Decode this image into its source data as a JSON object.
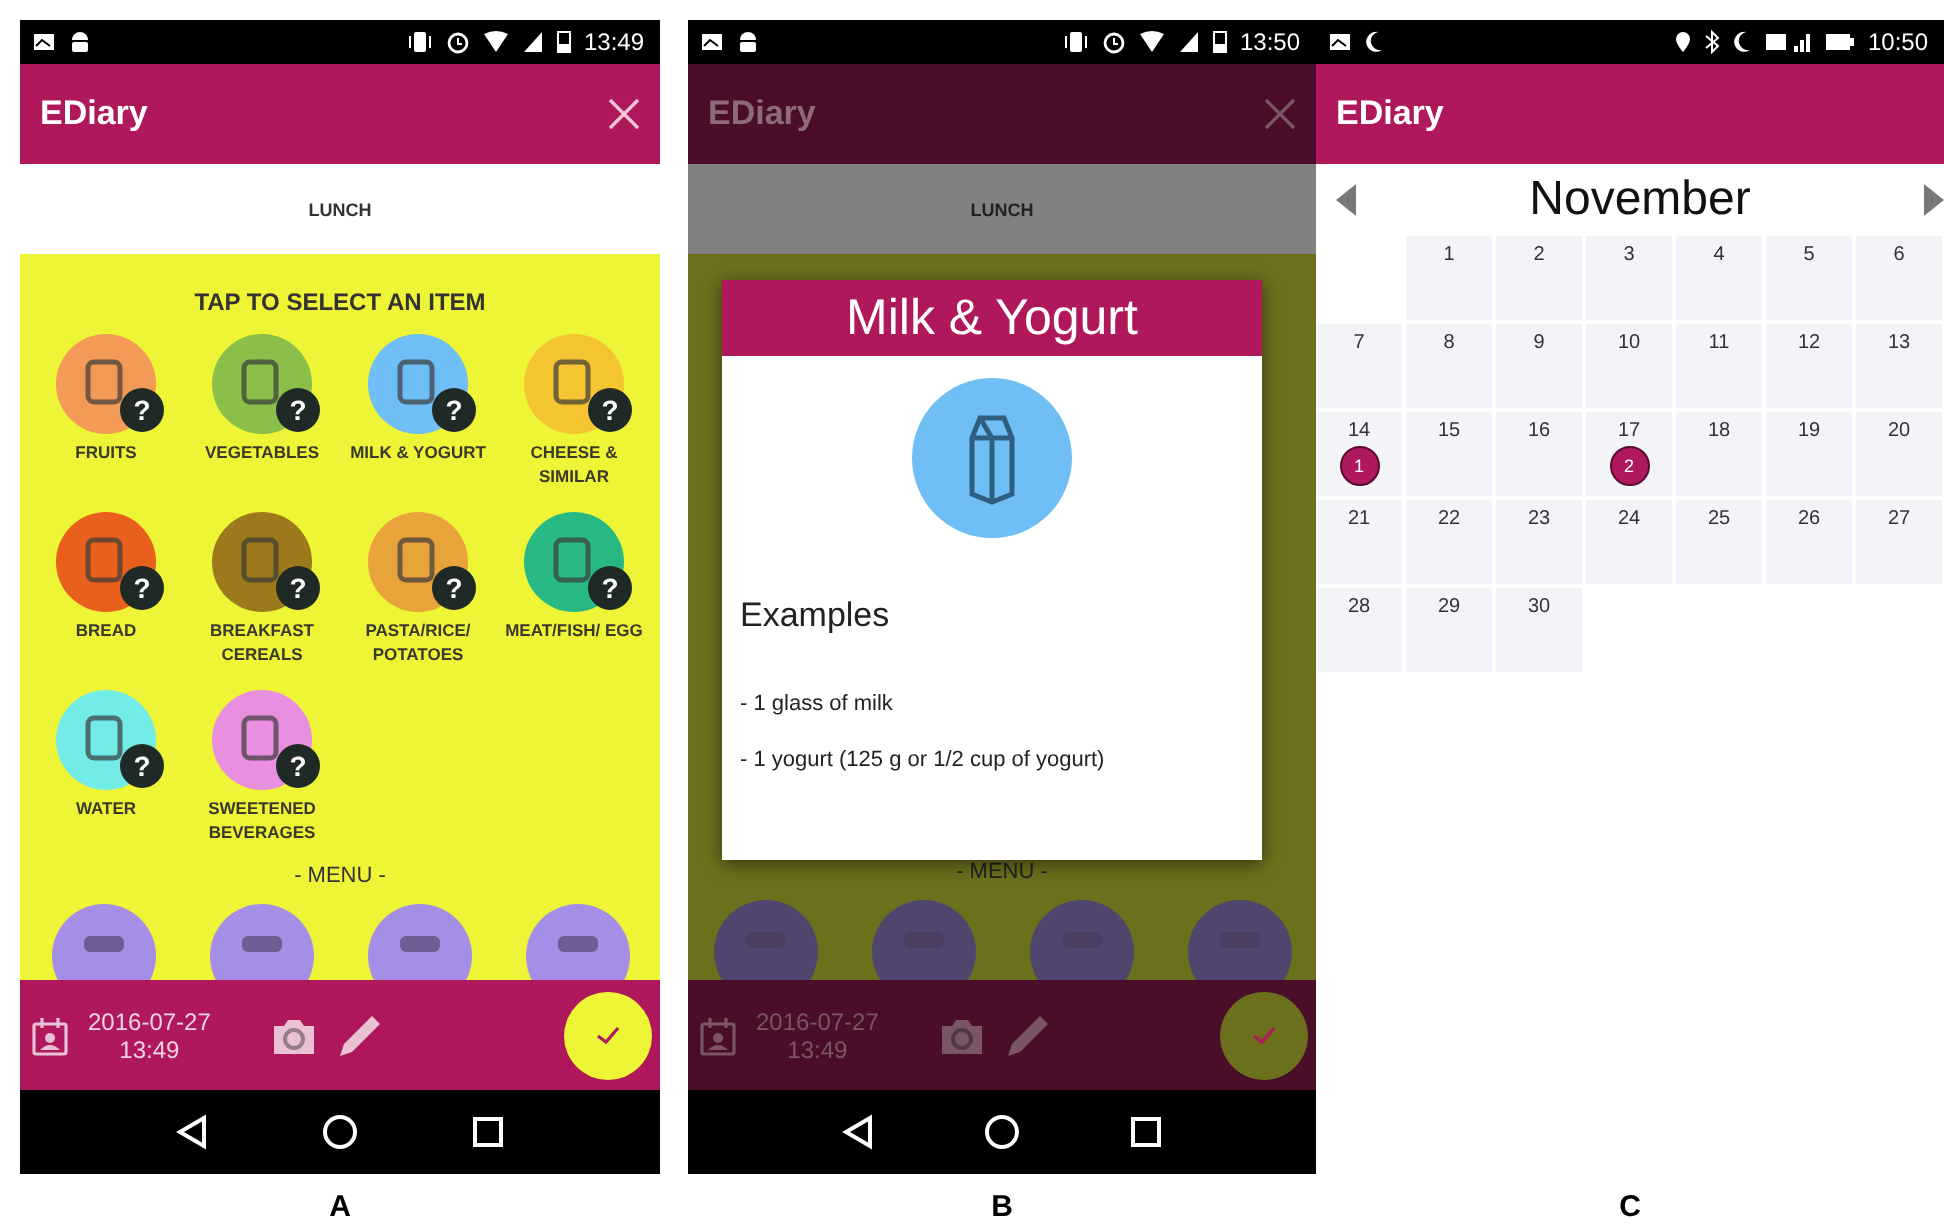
{
  "panels": [
    {
      "label": "A",
      "kind": "selector",
      "status_bar": {
        "time": "13:49"
      },
      "app_bar": {
        "title": "EDiary"
      },
      "tab": "LUNCH",
      "heading": "TAP TO SELECT AN ITEM",
      "categories": [
        {
          "label": "FRUITS",
          "color": "#f39a57",
          "badge": "?"
        },
        {
          "label": "VEGETABLES",
          "color": "#8bbf4a",
          "badge": "?"
        },
        {
          "label": "MILK & YOGURT",
          "color": "#6fbef5",
          "badge": "?"
        },
        {
          "label": "CHEESE & SIMILAR",
          "color": "#f4c431",
          "badge": "?"
        },
        {
          "label": "BREAD",
          "color": "#e8601c",
          "badge": "?"
        },
        {
          "label": "BREAKFAST CEREALS",
          "color": "#9c7a1b",
          "badge": "?"
        },
        {
          "label": "PASTA/RICE/ POTATOES",
          "color": "#e8a43a",
          "badge": "?"
        },
        {
          "label": "MEAT/FISH/ EGG",
          "color": "#27b884",
          "badge": "?"
        },
        {
          "label": "WATER",
          "color": "#73ebe6",
          "badge": "?"
        },
        {
          "label": "SWEETENED BEVERAGES",
          "color": "#e98fe0",
          "badge": "?"
        }
      ],
      "menu_heading": "- MENU -",
      "bottom_bar": {
        "date": "2016-07-27",
        "time": "13:49"
      }
    },
    {
      "label": "B",
      "kind": "dialog",
      "status_bar": {
        "time": "13:50"
      },
      "app_bar": {
        "title": "EDiary"
      },
      "tab": "LUNCH",
      "menu_heading": "- MENU -",
      "bottom_bar": {
        "date": "2016-07-27",
        "time": "13:49"
      },
      "dialog": {
        "title": "Milk & Yogurt",
        "heading": "Examples",
        "items": [
          "- 1 glass of milk",
          "- 1 yogurt (125 g or 1/2 cup of yogurt)"
        ]
      }
    },
    {
      "label": "C",
      "kind": "calendar",
      "status_bar": {
        "time": "10:50"
      },
      "app_bar": {
        "title": "EDiary"
      },
      "month": "November",
      "weeks": [
        [
          {
            "kind": "blank"
          },
          {
            "kind": "day",
            "day": "1"
          },
          {
            "kind": "day",
            "day": "2"
          },
          {
            "kind": "day",
            "day": "3"
          },
          {
            "kind": "day",
            "day": "4"
          },
          {
            "kind": "day",
            "day": "5"
          },
          {
            "kind": "day",
            "day": "6"
          }
        ],
        [
          {
            "kind": "day",
            "day": "7"
          },
          {
            "kind": "day",
            "day": "8"
          },
          {
            "kind": "day",
            "day": "9"
          },
          {
            "kind": "day",
            "day": "10"
          },
          {
            "kind": "day",
            "day": "11"
          },
          {
            "kind": "day",
            "day": "12"
          },
          {
            "kind": "day",
            "day": "13"
          }
        ],
        [
          {
            "kind": "day",
            "day": "14",
            "badge": "1"
          },
          {
            "kind": "day",
            "day": "15"
          },
          {
            "kind": "day",
            "day": "16"
          },
          {
            "kind": "day",
            "day": "17",
            "badge": "2"
          },
          {
            "kind": "day",
            "day": "18"
          },
          {
            "kind": "day",
            "day": "19"
          },
          {
            "kind": "day",
            "day": "20"
          }
        ],
        [
          {
            "kind": "day",
            "day": "21"
          },
          {
            "kind": "day",
            "day": "22"
          },
          {
            "kind": "day",
            "day": "23"
          },
          {
            "kind": "day",
            "day": "24"
          },
          {
            "kind": "day",
            "day": "25"
          },
          {
            "kind": "day",
            "day": "26"
          },
          {
            "kind": "day",
            "day": "27"
          }
        ],
        [
          {
            "kind": "day",
            "day": "28"
          },
          {
            "kind": "day",
            "day": "29"
          },
          {
            "kind": "day",
            "day": "30"
          }
        ]
      ]
    }
  ]
}
